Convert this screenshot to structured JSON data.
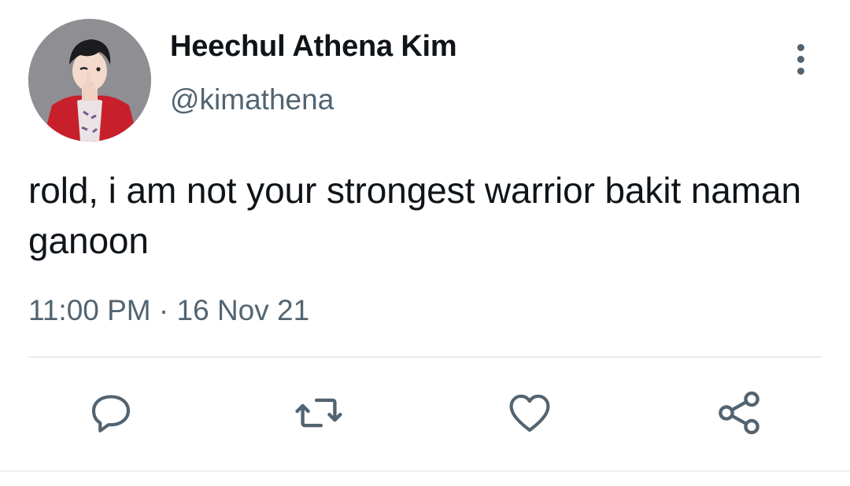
{
  "author": {
    "display_name": "Heechul Athena Kim",
    "handle": "@kimathena"
  },
  "tweet": {
    "text": "rold, i am not your strongest warrior bakit naman ganoon",
    "timestamp": "11:00 PM · 16 Nov 21"
  },
  "icons": {
    "more": "more-vertical-icon",
    "reply": "reply-icon",
    "retweet": "retweet-icon",
    "like": "heart-icon",
    "share": "share-icon"
  },
  "colors": {
    "text": "#0f1419",
    "secondary": "#536471",
    "divider": "#e6ecf0",
    "avatar_jacket": "#c8202a"
  }
}
